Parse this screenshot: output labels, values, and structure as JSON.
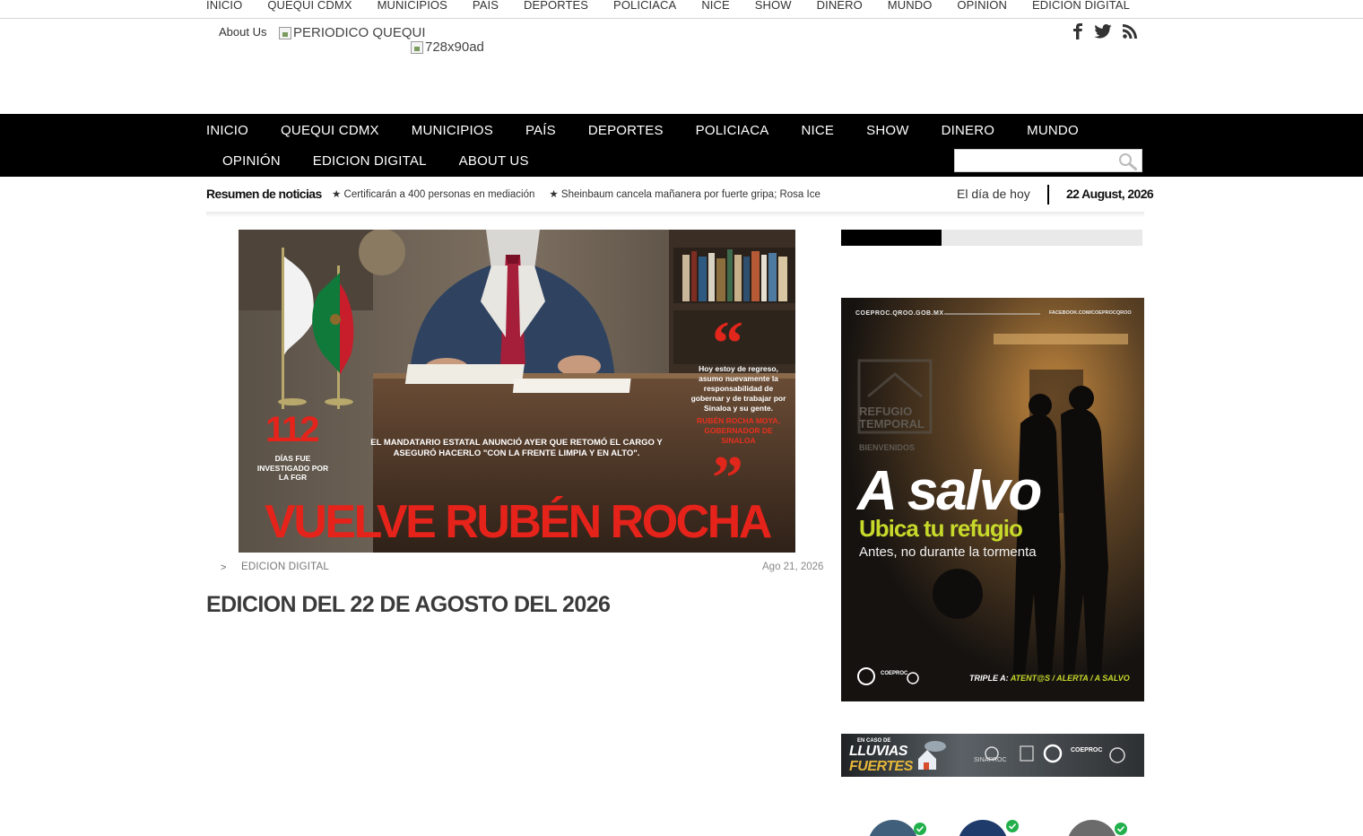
{
  "top_nav": [
    "INICIO",
    "QUEQUI CDMX",
    "MUNICIPIOS",
    "PAIS",
    "DEPORTES",
    "POLICIACA",
    "NICE",
    "SHOW",
    "DINERO",
    "MUNDO",
    "OPINION",
    "EDICION DIGITAL"
  ],
  "header": {
    "about_us": "About Us",
    "logo_alt": "PERIODICO QUEQUI",
    "ad_alt": "728x90ad"
  },
  "social": {
    "icons": [
      "facebook-icon",
      "twitter-icon",
      "rss-icon"
    ]
  },
  "main_nav": {
    "row1": [
      "INICIO",
      "QUEQUI CDMX",
      "MUNICIPIOS",
      "PAÍS",
      "DEPORTES",
      "POLICIACA",
      "NICE",
      "SHOW",
      "DINERO",
      "MUNDO"
    ],
    "row2": [
      "OPINIÓN",
      "EDICION DIGITAL",
      "ABOUT US"
    ]
  },
  "search": {
    "placeholder": ""
  },
  "ticker": {
    "label": "Resumen de noticias",
    "items": [
      "Certificarán a 400 personas en mediación",
      "Sheinbaum cancela mañanera por fuerte gripa; Rosa Ice"
    ],
    "date_label": "El día de hoy",
    "date": "22 August, 2026"
  },
  "article": {
    "image": {
      "quote": "Hoy estoy de regreso, asumo nuevamente la responsabilidad de gobernar y de trabajar por Sinaloa y su gente.",
      "quote_author": "RUBÉN ROCHA MOYA, GOBERNADOR DE SINALOA",
      "stat_number": "112",
      "stat_text": "DÍAS FUE INVESTIGADO POR LA FGR",
      "caption": "EL MANDATARIO ESTATAL ANUNCIÓ AYER QUE RETOMÓ EL CARGO Y ASEGURÓ HACERLO \"CON LA FRENTE LIMPIA Y EN ALTO\".",
      "banner": "VUELVE RUBÉN ROCHA"
    },
    "breadcrumb_sep": ">",
    "category": "EDICION DIGITAL",
    "date": "Ago 21, 2026",
    "title": "EDICION DEL 22 DE AGOSTO DEL 2026"
  },
  "sidebar": {
    "ad1": {
      "site": "COEPROC.QROO.GOB.MX",
      "social": "FACEBOOK.COM/COEPROCQROO",
      "sign1": "REFUGIO",
      "sign2": "TEMPORAL",
      "sign3": "BIENVENIDOS",
      "headline": "A salvo",
      "subhead": "Ubica tu refugio",
      "tagline": "Antes, no durante la tormenta",
      "footer_prefix": "TRIPLE A:",
      "footer_items": "ATENT@S / ALERTA / A SALVO",
      "org": "COEPROC"
    },
    "ad2": {
      "small": "EN CASO DE",
      "line1": "LLUVIAS",
      "line2": "FUERTES",
      "org1": "SINAPROC",
      "org2": "COEPROC"
    }
  }
}
